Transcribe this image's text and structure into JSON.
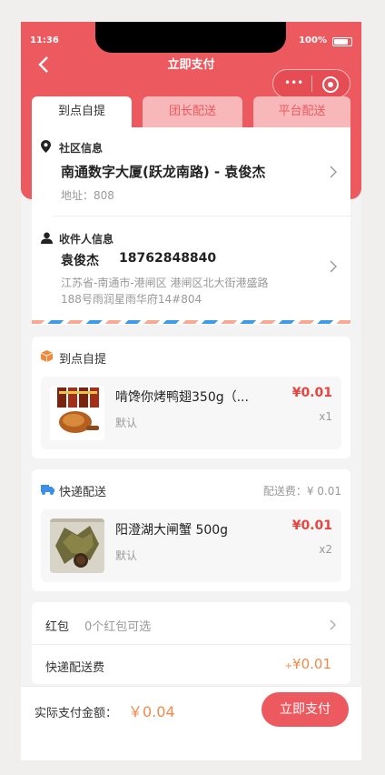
{
  "status_bar": {
    "time": "11:36",
    "battery": "100%"
  },
  "header": {
    "title": "立即支付",
    "capsule_dots": "•••"
  },
  "tabs": [
    {
      "label": "到点自提",
      "active": true
    },
    {
      "label": "团长配送",
      "active": false
    },
    {
      "label": "平台配送",
      "active": false
    }
  ],
  "community": {
    "title": "社区信息",
    "name": "南通数字大厦(跃龙南路) - 袁俊杰",
    "address": "地址：808"
  },
  "receiver": {
    "title": "收件人信息",
    "name": "袁俊杰",
    "phone": "18762848840",
    "address_line1": "江苏省-南通市-港闸区 港闸区北大街港盛路",
    "address_line2": "188号雨润星雨华府14#804"
  },
  "pickup_section": {
    "title": "到点自提",
    "item": {
      "name": "啃馋你烤鸭翅350g（...",
      "spec": "默认",
      "price": "¥0.01",
      "qty": "x1"
    }
  },
  "express_section": {
    "title": "快递配送",
    "fee_label": "配送费：¥ 0.01",
    "item": {
      "name": "阳澄湖大闸蟹 500g",
      "spec": "默认",
      "price": "¥0.01",
      "qty": "x2"
    }
  },
  "summary": {
    "redpacket_label": "红包",
    "redpacket_value": "0个红包可选",
    "express_fee_label": "快递配送费",
    "express_fee_prefix": "+",
    "express_fee_value": "¥0.01"
  },
  "footer": {
    "total_label": "实际支付金额：",
    "total_value": "￥0.04",
    "pay_button": "立即支付"
  },
  "colors": {
    "primary": "#ec5a60",
    "price": "#e6453f",
    "fee": "#f08a4b"
  }
}
